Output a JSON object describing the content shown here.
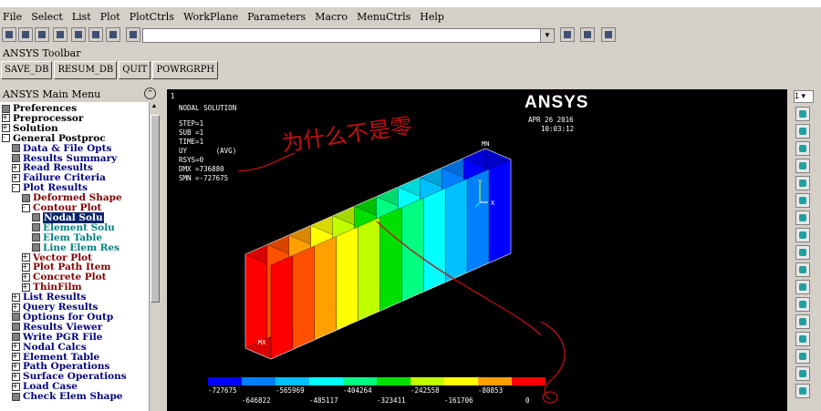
{
  "menubar": [
    "File",
    "Select",
    "List",
    "Plot",
    "PlotCtrls",
    "WorkPlane",
    "Parameters",
    "Macro",
    "MenuCtrls",
    "Help"
  ],
  "toolbar_label": "ANSYS Toolbar",
  "toolbar_buttons": [
    "SAVE_DB",
    "RESUM_DB",
    "QUIT",
    "POWRGRPH"
  ],
  "main_menu_title": "ANSYS Main Menu",
  "tree": [
    {
      "label": "Preferences",
      "indent": 0,
      "icon": "box",
      "color": "#000"
    },
    {
      "label": "Preprocessor",
      "indent": 0,
      "icon": "plus",
      "color": "#000"
    },
    {
      "label": "Solution",
      "indent": 0,
      "icon": "plus",
      "color": "#000"
    },
    {
      "label": "General Postproc",
      "indent": 0,
      "icon": "minus",
      "color": "#000"
    },
    {
      "label": "Data & File Opts",
      "indent": 1,
      "icon": "box",
      "color": "#000080"
    },
    {
      "label": "Results Summary",
      "indent": 1,
      "icon": "box",
      "color": "#000080"
    },
    {
      "label": "Read Results",
      "indent": 1,
      "icon": "plus",
      "color": "#000080"
    },
    {
      "label": "Failure Criteria",
      "indent": 1,
      "icon": "plus",
      "color": "#000080"
    },
    {
      "label": "Plot Results",
      "indent": 1,
      "icon": "minus",
      "color": "#000080"
    },
    {
      "label": "Deformed Shape",
      "indent": 2,
      "icon": "box",
      "color": "#800000"
    },
    {
      "label": "Contour Plot",
      "indent": 2,
      "icon": "minus",
      "color": "#800000"
    },
    {
      "label": "Nodal Solu",
      "indent": 3,
      "icon": "box",
      "color": "#ffffff",
      "selected": true
    },
    {
      "label": "Element Solu",
      "indent": 3,
      "icon": "box",
      "color": "#008080"
    },
    {
      "label": "Elem Table",
      "indent": 3,
      "icon": "box",
      "color": "#008080"
    },
    {
      "label": "Line Elem Res",
      "indent": 3,
      "icon": "box",
      "color": "#008080"
    },
    {
      "label": "Vector Plot",
      "indent": 2,
      "icon": "plus",
      "color": "#800000"
    },
    {
      "label": "Plot Path Item",
      "indent": 2,
      "icon": "plus",
      "color": "#800000"
    },
    {
      "label": "Concrete Plot",
      "indent": 2,
      "icon": "plus",
      "color": "#800000"
    },
    {
      "label": "ThinFilm",
      "indent": 2,
      "icon": "plus",
      "color": "#800000"
    },
    {
      "label": "List Results",
      "indent": 1,
      "icon": "plus",
      "color": "#000080"
    },
    {
      "label": "Query Results",
      "indent": 1,
      "icon": "plus",
      "color": "#000080"
    },
    {
      "label": "Options for Outp",
      "indent": 1,
      "icon": "box",
      "color": "#000080"
    },
    {
      "label": "Results Viewer",
      "indent": 1,
      "icon": "box",
      "color": "#000080"
    },
    {
      "label": "Write PGR File",
      "indent": 1,
      "icon": "box",
      "color": "#000080"
    },
    {
      "label": "Nodal Calcs",
      "indent": 1,
      "icon": "plus",
      "color": "#000080"
    },
    {
      "label": "Element Table",
      "indent": 1,
      "icon": "plus",
      "color": "#000080"
    },
    {
      "label": "Path Operations",
      "indent": 1,
      "icon": "plus",
      "color": "#000080"
    },
    {
      "label": "Surface Operations",
      "indent": 1,
      "icon": "plus",
      "color": "#000080"
    },
    {
      "label": "Load Case",
      "indent": 1,
      "icon": "plus",
      "color": "#000080"
    },
    {
      "label": "Check Elem Shape",
      "indent": 1,
      "icon": "box",
      "color": "#000080"
    }
  ],
  "graphics": {
    "window_number": "1",
    "title": "NODAL SOLUTION",
    "info": [
      "STEP=1",
      "SUB =1",
      "TIME=1",
      "UY       (AVG)",
      "RSYS=0",
      "DMX =736880",
      "SMN =-727675"
    ],
    "logo": "ANSYS",
    "date": "APR 26 2016",
    "time": "10:03:12",
    "mn_label": "MN",
    "mx_label": "MX",
    "axis_y": "Y",
    "axis_x": "X",
    "annotation": "为什么不是零",
    "legend_colors": [
      "#0000ff",
      "#0080ff",
      "#00c0ff",
      "#00ffff",
      "#00ff80",
      "#00e000",
      "#c0ff00",
      "#ffff00",
      "#ffa000",
      "#ff0000"
    ],
    "legend_top": [
      "-727675",
      "-565969",
      "-404264",
      "-242558",
      "-80853"
    ],
    "legend_bottom": [
      "-646822",
      "-485117",
      "-323411",
      "-161706",
      "0"
    ]
  },
  "right_select": "1"
}
